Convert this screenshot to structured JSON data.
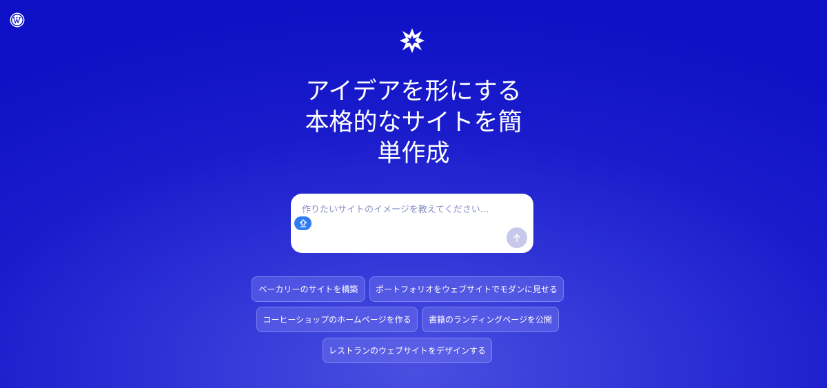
{
  "icons": {
    "wordpress": "wordpress-logo-icon",
    "brand": "sparkle-star-icon",
    "upload": "upload-icon",
    "send": "arrow-up-icon"
  },
  "colors": {
    "background": "#1a1ccc",
    "chip_bg": "#5a5fe6",
    "upload_button": "#2f7df0",
    "send_button": "#c7c8ea",
    "placeholder": "#8a8fc6"
  },
  "hero": {
    "headline_lines": [
      "アイデアを形にする",
      "本格的なサイトを簡",
      "単作成"
    ]
  },
  "prompt": {
    "placeholder": "作りたいサイトのイメージを教えてください...",
    "value": ""
  },
  "suggestions": [
    "ベーカリーのサイトを構築",
    "ポートフォリオをウェブサイトでモダンに見せる",
    "コーヒーショップのホームページを作る",
    "書籍のランディングページを公開",
    "レストランのウェブサイトをデザインする"
  ]
}
